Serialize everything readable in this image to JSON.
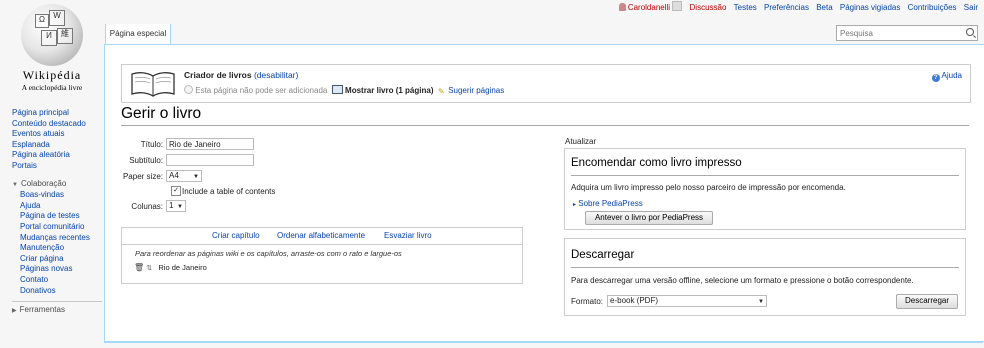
{
  "personal": {
    "user": "Caroldanelli",
    "items": [
      "Discussão",
      "Testes",
      "Preferências",
      "Beta",
      "Páginas vigiadas",
      "Contribuições",
      "Sair"
    ]
  },
  "logo": {
    "wordmark": "Wikipédia",
    "tagline": "A enciclopédia livre",
    "glyphs": [
      "Ω",
      "W",
      "И",
      "維"
    ]
  },
  "sidebar": {
    "nav": [
      "Página principal",
      "Conteúdo destacado",
      "Eventos atuais",
      "Esplanada",
      "Página aleatória",
      "Portais"
    ],
    "collab_title": "Colaboração",
    "collab": [
      "Boas-vindas",
      "Ajuda",
      "Página de testes",
      "Portal comunitário",
      "Mudanças recentes",
      "Manutenção",
      "Criar página",
      "Páginas novas",
      "Contato",
      "Donativos"
    ],
    "tools_title": "Ferramentas"
  },
  "tab": {
    "label": "Página especial"
  },
  "search": {
    "placeholder": "Pesquisa"
  },
  "bookbox": {
    "title": "Criador de livros",
    "disable_label": "(desabilitar)",
    "cannot_add": "Esta página não pode ser adicionada",
    "show_book": "Mostrar livro (1 página)",
    "suggest": "Sugerir páginas",
    "help": "Ajuda"
  },
  "page_title": "Gerir o livro",
  "form": {
    "title_label": "Título:",
    "title_value": "Rio de Janeiro",
    "subtitle_label": "Subtítulo:",
    "subtitle_value": "",
    "paper_label": "Paper size:",
    "paper_value": "A4",
    "toc_label": "Include a table of contents",
    "toc_checked": true,
    "columns_label": "Colunas:",
    "columns_value": "1"
  },
  "chapters": {
    "actions": [
      "Criar capítulo",
      "Ordenar alfabeticamente",
      "Esvaziar livro"
    ],
    "instructions": "Para reordenar as páginas wiki e os capítulos, arraste-os com o rato e largue-os",
    "items": [
      "Rio de Janeiro"
    ]
  },
  "right": {
    "refresh": "Atualizar",
    "order": {
      "title": "Encomendar como livro impresso",
      "desc": "Adquira um livro impresso pelo nosso parceiro de impressão por encomenda.",
      "about": "Sobre PediaPress",
      "button": "Antever o livro por PediaPress"
    },
    "download": {
      "title": "Descarregar",
      "desc": "Para descarregar uma versão offline, selecione um formato e pressione o botão correspondente.",
      "format_label": "Formato:",
      "format_value": "e-book (PDF)",
      "button": "Descarregar"
    }
  },
  "colors": {
    "link": "#0645ad",
    "red_link": "#ba0000",
    "border_blue": "#a7d7f9"
  }
}
